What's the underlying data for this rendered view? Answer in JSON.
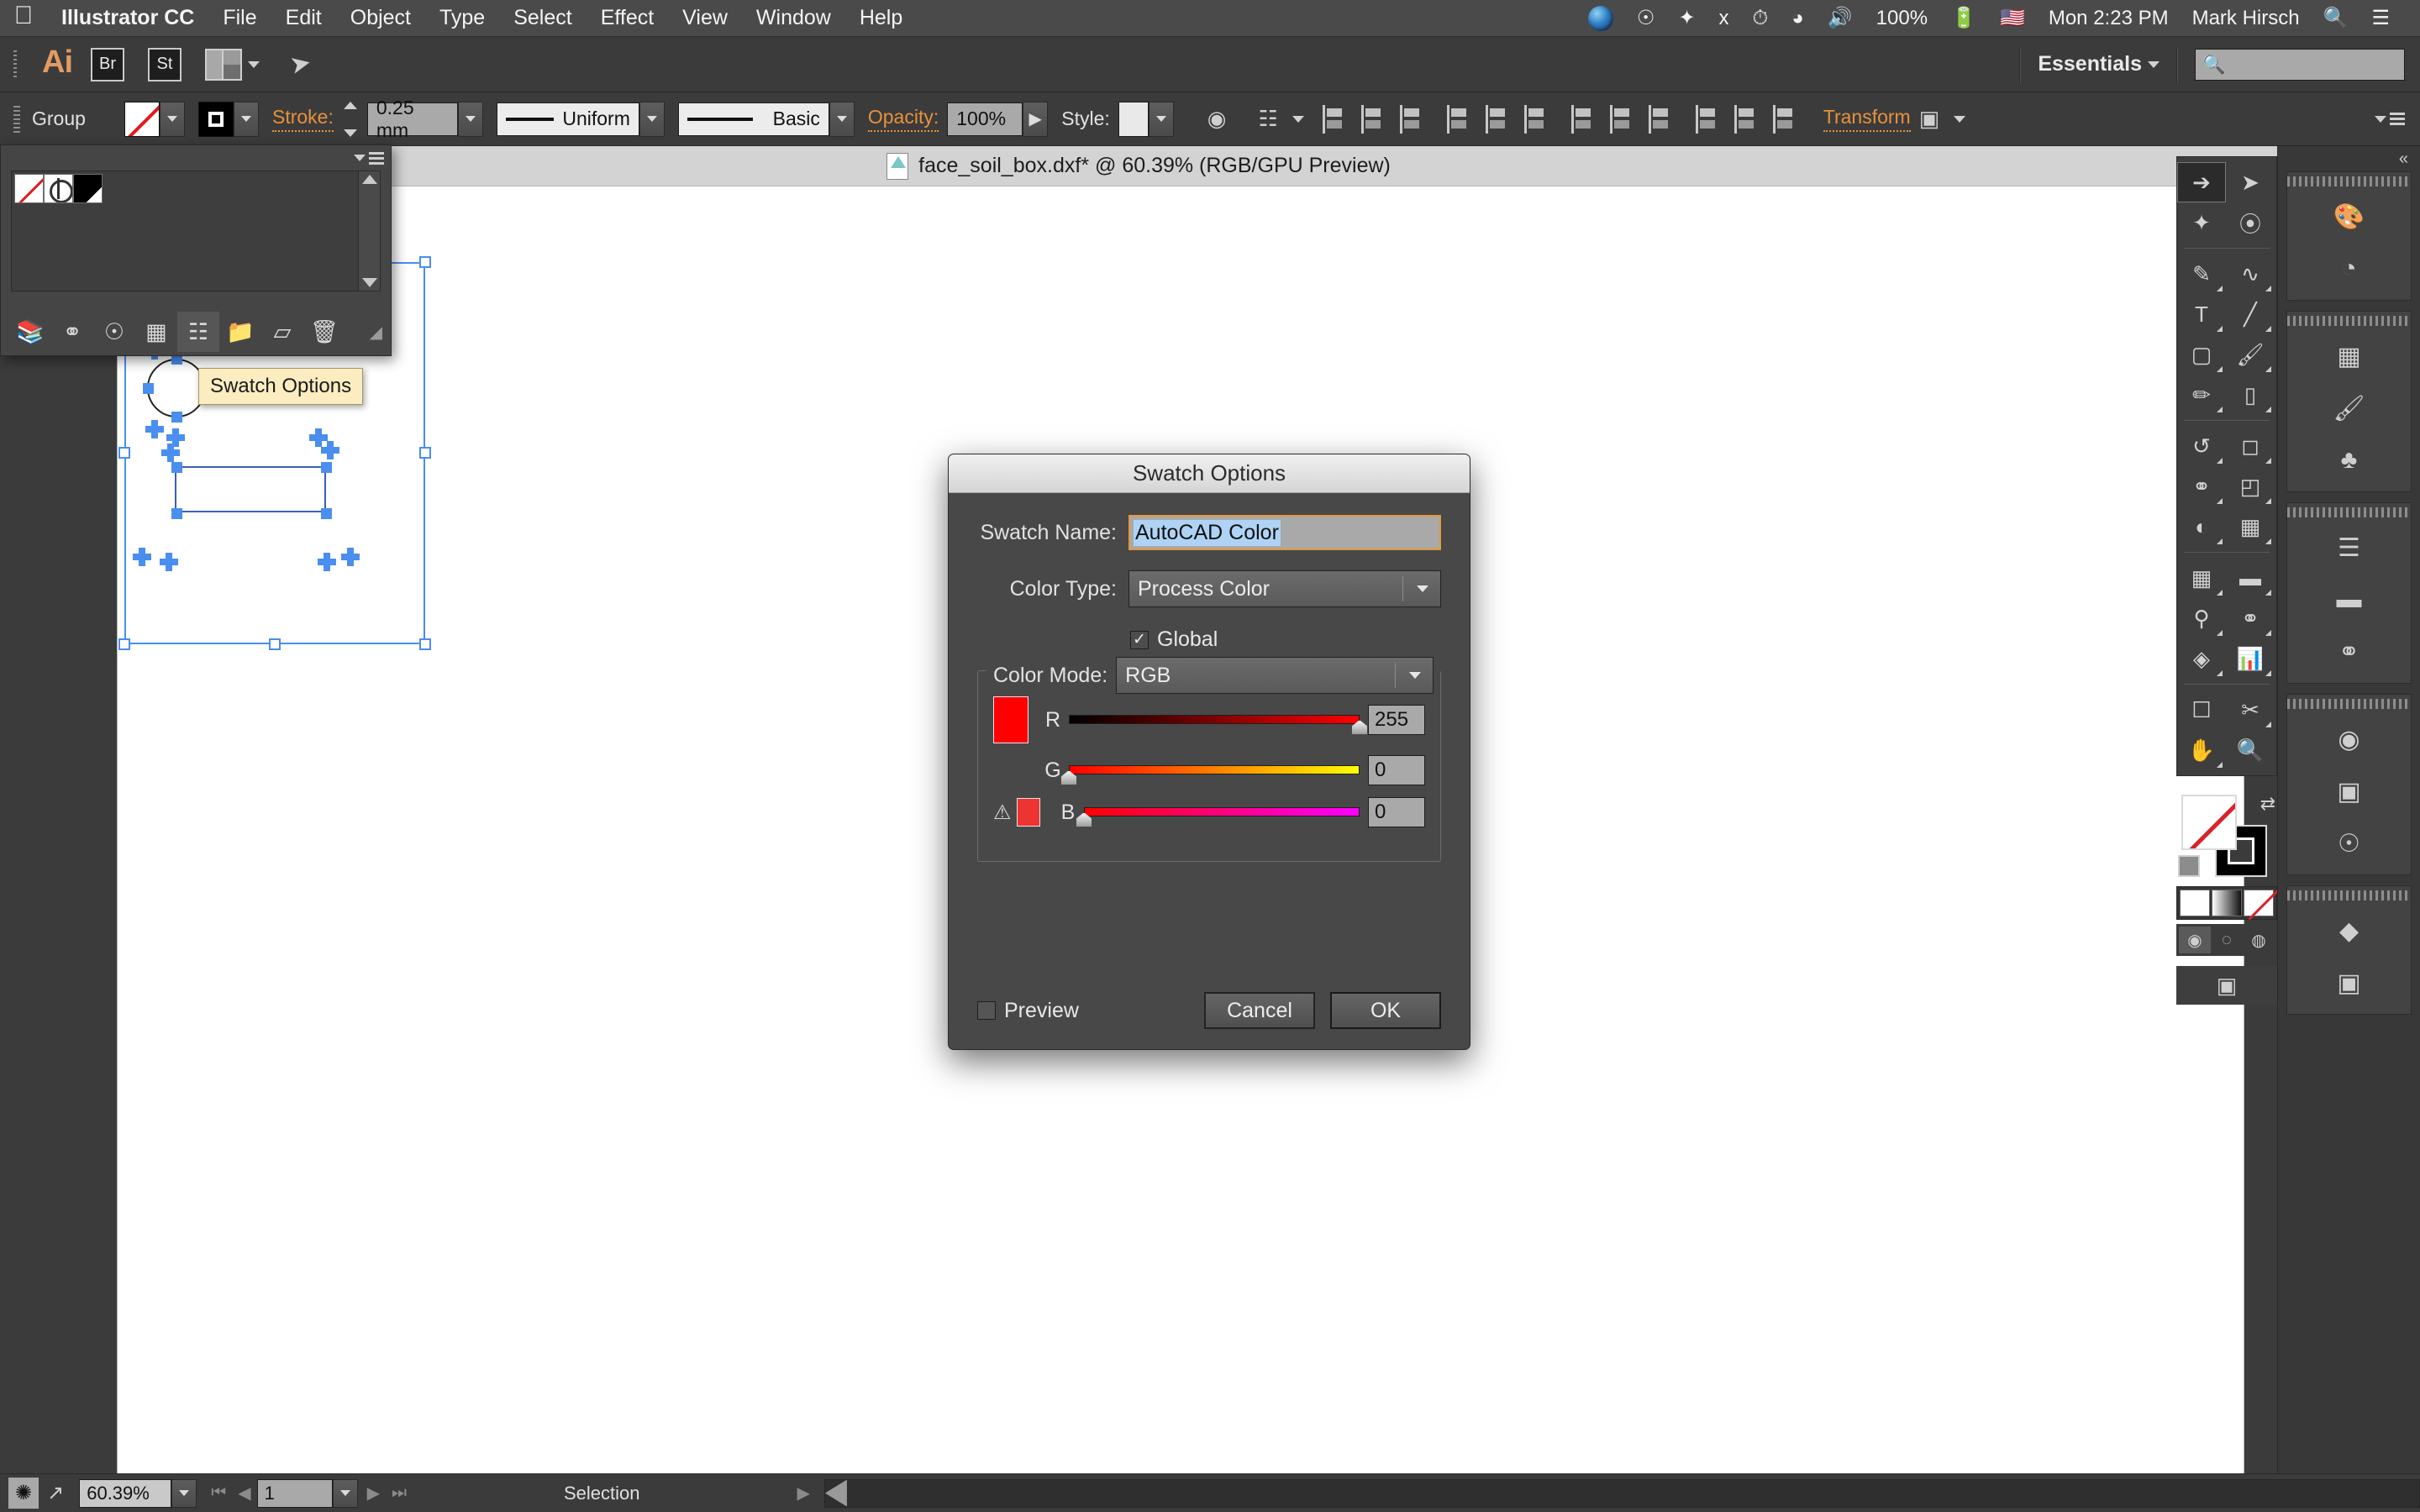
{
  "macbar": {
    "apple_icon": "apple-icon",
    "menus": [
      "Illustrator CC",
      "File",
      "Edit",
      "Object",
      "Type",
      "Select",
      "Effect",
      "View",
      "Window",
      "Help"
    ],
    "status": {
      "battery_percent": "100%",
      "datetime": "Mon 2:23 PM",
      "user": "Mark Hirsch",
      "icons": [
        "siri-icon",
        "creative-cloud-icon",
        "dropbox-icon",
        "bluetooth-icon",
        "timemachine-icon",
        "wifi-icon",
        "volume-icon",
        "battery-icon",
        "flag-icon",
        "spotlight-icon",
        "notification-center-icon"
      ]
    }
  },
  "appbar": {
    "app_logo": "Ai",
    "bridge_label": "Br",
    "stock_label": "St",
    "arrange_icon": "arrange-documents-icon",
    "rocket_icon": "rocket-icon",
    "workspace": "Essentials",
    "search_placeholder": "",
    "search_icon": "search-icon"
  },
  "controlbar": {
    "selection_label": "Group",
    "fill_swatch": "none-fill-swatch",
    "stroke_swatch": "black-stroke-swatch",
    "stroke_label": "Stroke:",
    "stroke_weight": "0.25 mm",
    "stroke_profile": "Uniform",
    "brush_definition": "Basic",
    "opacity_label": "Opacity:",
    "opacity_value": "100%",
    "style_label": "Style:",
    "transform_label": "Transform",
    "align_icons": [
      "align-left-icon",
      "align-center-horizontal-icon",
      "align-right-icon",
      "align-top-icon",
      "align-middle-vertical-icon",
      "align-bottom-icon",
      "distribute-top-icon",
      "distribute-center-vertical-icon",
      "distribute-bottom-icon",
      "distribute-left-icon",
      "distribute-center-horizontal-icon",
      "distribute-right-icon"
    ],
    "recolor_icon": "recolor-artwork-icon",
    "isolate_icon": "isolate-selected-icon",
    "panel_menu_icon": "panel-menu-icon"
  },
  "swatches_panel": {
    "menu_icon": "panel-menu-icon",
    "swatches": [
      "none-swatch",
      "registration-swatch",
      "black-swatch"
    ],
    "footer_buttons": [
      {
        "name": "swatch-libraries-button",
        "icon": "library-icon"
      },
      {
        "name": "color-groups-button",
        "icon": "color-group-icon"
      },
      {
        "name": "libraries-button",
        "icon": "cc-libraries-icon"
      },
      {
        "name": "show-swatch-kinds-button",
        "icon": "swatch-kinds-icon"
      },
      {
        "name": "swatch-options-button",
        "icon": "swatch-options-icon"
      },
      {
        "name": "new-color-group-button",
        "icon": "folder-icon"
      },
      {
        "name": "new-swatch-button",
        "icon": "new-swatch-icon"
      },
      {
        "name": "delete-swatch-button",
        "icon": "trash-icon"
      }
    ]
  },
  "tooltip": {
    "text": "Swatch Options"
  },
  "document": {
    "tab_title": "face_soil_box.dxf* @ 60.39% (RGB/GPU Preview)",
    "file_icon": "dxf-file-icon"
  },
  "dialog": {
    "title": "Swatch Options",
    "swatch_name_label": "Swatch Name:",
    "swatch_name_value": "AutoCAD Color",
    "color_type_label": "Color Type:",
    "color_type_value": "Process Color",
    "global_label": "Global",
    "global_checked": true,
    "color_mode_label": "Color Mode:",
    "color_mode_value": "RGB",
    "preview_label": "Preview",
    "preview_checked": false,
    "cancel_label": "Cancel",
    "ok_label": "OK",
    "color_preview_hex": "#ff0000",
    "out_of_gamut_hex": "#ee3333",
    "warning_icon": "out-of-gamut-warning-icon",
    "channels": [
      {
        "label": "R",
        "value": "255",
        "percent": 100,
        "gradient_from": "#000000",
        "gradient_to": "#ff0000"
      },
      {
        "label": "G",
        "value": "0",
        "percent": 0,
        "gradient_from": "#ff0000",
        "gradient_to": "#ffff00"
      },
      {
        "label": "B",
        "value": "0",
        "percent": 0,
        "gradient_from": "#ff0000",
        "gradient_to": "#ff00ff"
      }
    ]
  },
  "tools": [
    [
      {
        "name": "selection-tool",
        "icon": "arrow-icon",
        "selected": true
      },
      {
        "name": "direct-selection-tool",
        "icon": "white-arrow-icon",
        "selected": false
      }
    ],
    [
      {
        "name": "magic-wand-tool",
        "icon": "magic-wand-icon",
        "selected": false
      },
      {
        "name": "lasso-tool",
        "icon": "lasso-icon",
        "selected": false
      }
    ],
    [
      {
        "name": "pen-tool",
        "icon": "pen-icon",
        "selected": false
      },
      {
        "name": "curvature-tool",
        "icon": "curvature-icon",
        "selected": false
      }
    ],
    [
      {
        "name": "type-tool",
        "icon": "type-icon",
        "selected": false
      },
      {
        "name": "line-segment-tool",
        "icon": "line-icon",
        "selected": false
      }
    ],
    [
      {
        "name": "rectangle-tool",
        "icon": "rectangle-icon",
        "selected": false
      },
      {
        "name": "paintbrush-tool",
        "icon": "paintbrush-icon",
        "selected": false
      }
    ],
    [
      {
        "name": "pencil-tool",
        "icon": "pencil-icon",
        "selected": false
      },
      {
        "name": "eraser-tool",
        "icon": "eraser-icon",
        "selected": false
      }
    ],
    [
      {
        "name": "rotate-tool",
        "icon": "rotate-icon",
        "selected": false
      },
      {
        "name": "scale-tool",
        "icon": "scale-icon",
        "selected": false
      }
    ],
    [
      {
        "name": "width-tool",
        "icon": "width-icon",
        "selected": false
      },
      {
        "name": "free-transform-tool",
        "icon": "free-transform-icon",
        "selected": false
      }
    ],
    [
      {
        "name": "shape-builder-tool",
        "icon": "shape-builder-icon",
        "selected": false
      },
      {
        "name": "perspective-grid-tool",
        "icon": "perspective-grid-icon",
        "selected": false
      }
    ],
    [
      {
        "name": "mesh-tool",
        "icon": "mesh-icon",
        "selected": false
      },
      {
        "name": "gradient-tool",
        "icon": "gradient-icon",
        "selected": false
      }
    ],
    [
      {
        "name": "eyedropper-tool",
        "icon": "eyedropper-icon",
        "selected": false
      },
      {
        "name": "blend-tool",
        "icon": "blend-icon",
        "selected": false
      }
    ],
    [
      {
        "name": "symbol-sprayer-tool",
        "icon": "symbol-sprayer-icon",
        "selected": false
      },
      {
        "name": "column-graph-tool",
        "icon": "graph-icon",
        "selected": false
      }
    ],
    [
      {
        "name": "artboard-tool",
        "icon": "artboard-icon",
        "selected": false
      },
      {
        "name": "slice-tool",
        "icon": "slice-icon",
        "selected": false
      }
    ],
    [
      {
        "name": "hand-tool",
        "icon": "hand-icon",
        "selected": false
      },
      {
        "name": "zoom-tool",
        "icon": "magnifier-icon",
        "selected": false
      }
    ]
  ],
  "fill_stroke": {
    "fill": "none-fill-swatch",
    "stroke": "black-stroke-swatch",
    "swap_icon": "swap-fill-stroke-icon",
    "default_icon": "default-fill-stroke-icon",
    "modes": [
      "color-fill-mode",
      "gradient-fill-mode",
      "none-fill-mode"
    ],
    "draw_modes": [
      "draw-normal-mode",
      "draw-behind-mode",
      "draw-inside-mode"
    ],
    "screen_mode_icon": "change-screen-mode-icon"
  },
  "panel_dock": {
    "collapse_icon": "collapse-panels-icon",
    "groups": [
      [
        "color-panel-icon",
        "color-guide-panel-icon"
      ],
      [
        "swatches-panel-icon",
        "brushes-panel-icon",
        "symbols-panel-icon"
      ],
      [
        "stroke-panel-icon",
        "gradient-panel-icon",
        "transparency-panel-icon"
      ],
      [
        "appearance-panel-icon",
        "graphic-styles-panel-icon",
        "cc-libraries-panel-icon"
      ],
      [
        "layers-panel-icon",
        "artboards-panel-icon"
      ]
    ]
  },
  "statusbar": {
    "preflight_icon": "preflight-icon",
    "share_icon": "share-icon",
    "zoom_value": "60.39%",
    "page_value": "1",
    "status_text": "Selection",
    "first_icon": "first-page-icon",
    "prev_icon": "prev-page-icon",
    "next_icon": "next-page-icon",
    "last_icon": "last-page-icon"
  }
}
